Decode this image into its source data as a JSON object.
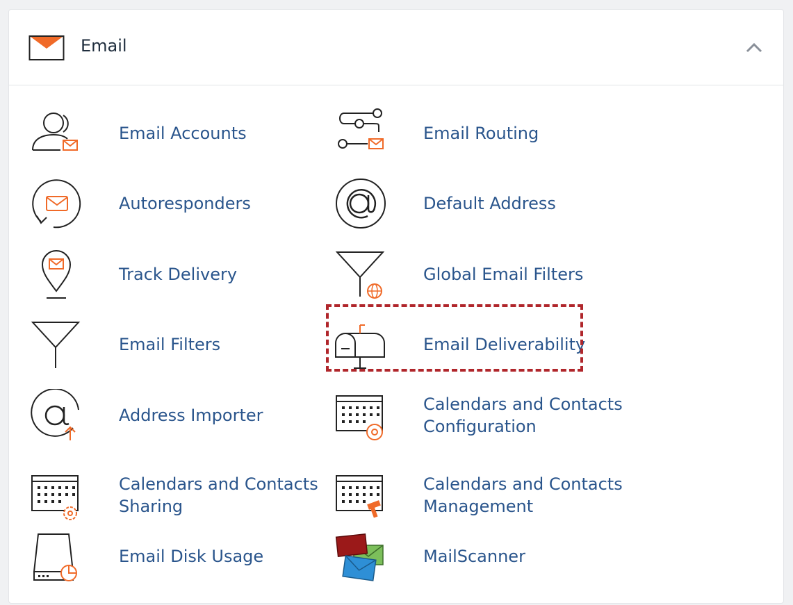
{
  "section": {
    "title": "Email",
    "header_icon": "envelope-icon",
    "collapse_icon": "chevron-up-icon"
  },
  "colors": {
    "accent_orange": "#f06a28",
    "link_blue": "#2a558c",
    "highlight_red": "#b0262b"
  },
  "items": [
    {
      "label": "Email Accounts",
      "icon": "email-accounts-icon"
    },
    {
      "label": "Email Routing",
      "icon": "email-routing-icon"
    },
    {
      "label": "Autoresponders",
      "icon": "autoresponders-icon"
    },
    {
      "label": "Default Address",
      "icon": "default-address-icon"
    },
    {
      "label": "Track Delivery",
      "icon": "track-delivery-icon"
    },
    {
      "label": "Global Email Filters",
      "icon": "global-email-filters-icon"
    },
    {
      "label": "Email Filters",
      "icon": "email-filters-icon"
    },
    {
      "label": "Email Deliverability",
      "icon": "email-deliverability-icon"
    },
    {
      "label": "Address Importer",
      "icon": "address-importer-icon"
    },
    {
      "label": "Calendars and Contacts Configuration",
      "icon": "calendar-config-icon"
    },
    {
      "label": "Calendars and Contacts Sharing",
      "icon": "calendar-sharing-icon"
    },
    {
      "label": "Calendars and Contacts Management",
      "icon": "calendar-management-icon"
    },
    {
      "label": "Email Disk Usage",
      "icon": "email-disk-usage-icon"
    },
    {
      "label": "MailScanner",
      "icon": "mailscanner-icon"
    }
  ]
}
